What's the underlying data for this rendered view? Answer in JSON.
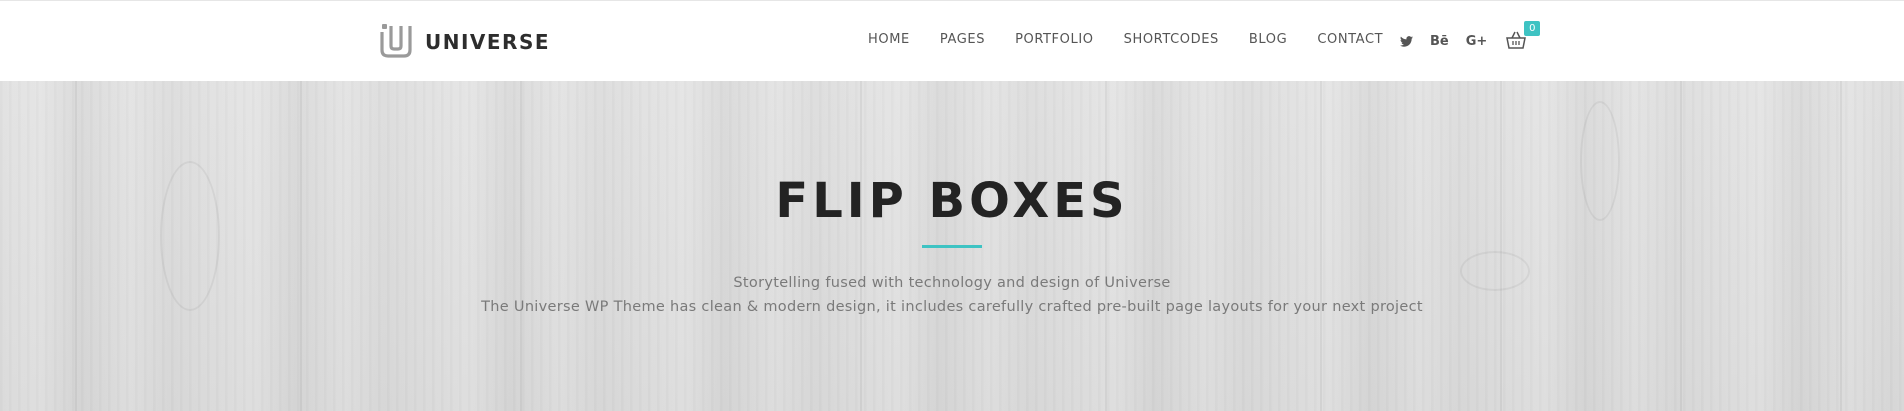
{
  "header": {
    "logo_text": "UNIVERSE",
    "nav": [
      {
        "label": "HOME"
      },
      {
        "label": "PAGES"
      },
      {
        "label": "PORTFOLIO"
      },
      {
        "label": "SHORTCODES"
      },
      {
        "label": "BLOG"
      },
      {
        "label": "CONTACT"
      }
    ],
    "social": {
      "behance_label": "Bē",
      "google_plus_label": "G+"
    },
    "cart": {
      "count": "0"
    }
  },
  "hero": {
    "title": "FLIP BOXES",
    "subtitle_line1": "Storytelling fused with technology and design of Universe",
    "subtitle_line2": "The Universe WP Theme has clean & modern design, it includes carefully crafted pre-built page layouts for your next project"
  },
  "colors": {
    "accent": "#3ec3c3",
    "nav_text": "#555555",
    "title_text": "#232323",
    "subtitle_text": "#7a7a7a"
  },
  "icons": [
    "universe-logo-icon",
    "twitter-icon",
    "behance-icon",
    "google-plus-icon",
    "shopping-basket-icon"
  ]
}
